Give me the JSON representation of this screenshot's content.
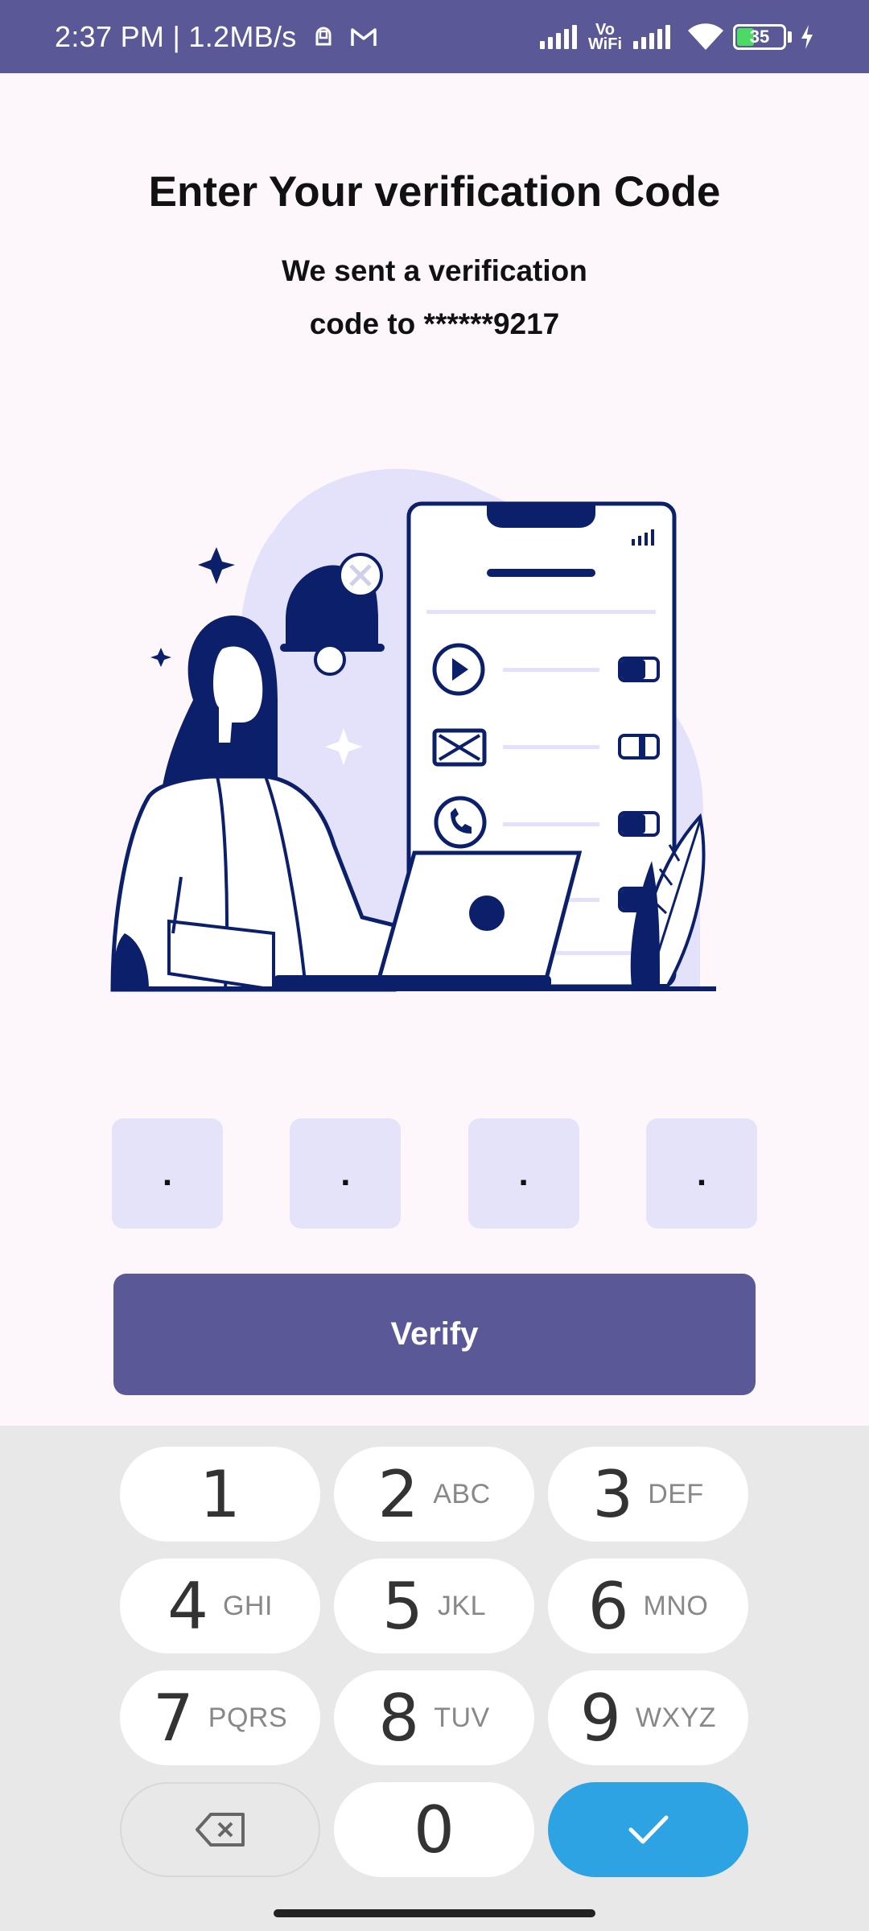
{
  "status_bar": {
    "time_speed": "2:37 PM | 1.2MB/s",
    "vowifi_top": "Vo",
    "vowifi_bottom": "WiFi",
    "battery": "35"
  },
  "header": {
    "title": "Enter Your verification Code",
    "subtitle_line1": "We sent a verification",
    "subtitle_line2": "code to ******9217"
  },
  "otp": {
    "placeholders": [
      ".",
      ".",
      ".",
      "."
    ]
  },
  "verify_button": {
    "label": "Verify"
  },
  "keyboard": {
    "keys": [
      {
        "digit": "1",
        "letters": ""
      },
      {
        "digit": "2",
        "letters": "ABC"
      },
      {
        "digit": "3",
        "letters": "DEF"
      },
      {
        "digit": "4",
        "letters": "GHI"
      },
      {
        "digit": "5",
        "letters": "JKL"
      },
      {
        "digit": "6",
        "letters": "MNO"
      },
      {
        "digit": "7",
        "letters": "PQRS"
      },
      {
        "digit": "8",
        "letters": "TUV"
      },
      {
        "digit": "9",
        "letters": "WXYZ"
      },
      {
        "digit": "0",
        "letters": ""
      }
    ]
  },
  "colors": {
    "primary": "#5b5897",
    "otp_box": "#e5e3fa",
    "done_key": "#2ea3e4",
    "illustration_navy": "#0b1f6b"
  }
}
